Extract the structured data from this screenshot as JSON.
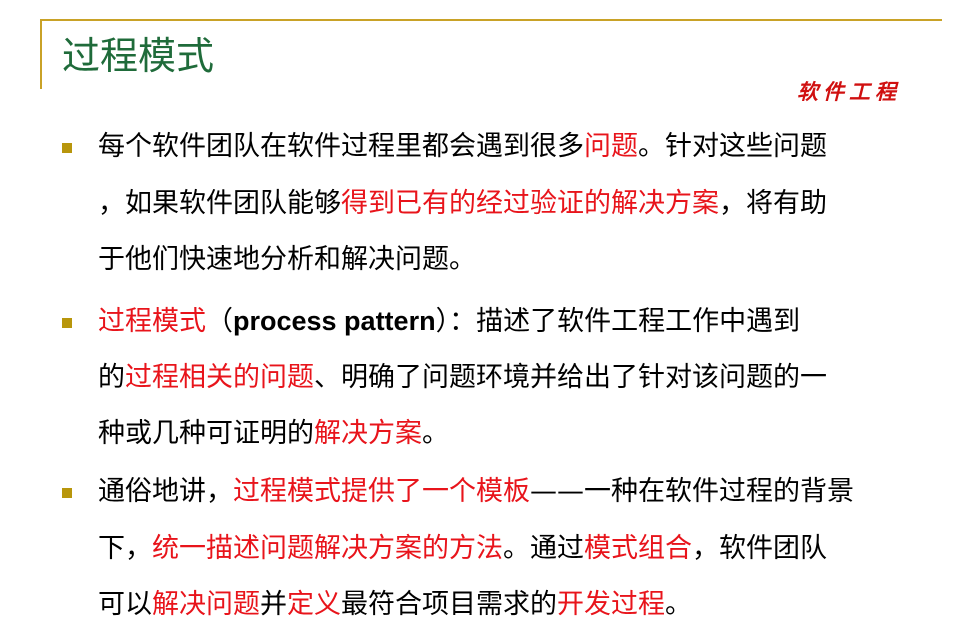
{
  "slide": {
    "title": "过程模式",
    "brand": "软件工程",
    "colors": {
      "title": "#1f6b3a",
      "accent_rule": "#c9a227",
      "bullet": "#b8960c",
      "highlight": "#e8141b",
      "text": "#000000"
    }
  },
  "p1": {
    "l1a": "每个软件团队在软件过程里都会遇到很多",
    "l1b": "问题",
    "l1c": "。针对这些问题",
    "l2a": "，如果软件团队能够",
    "l2b": "得到已有的经过验证的解决方案",
    "l2c": "，将有助",
    "l3a": "于他们快速地分析和解决问题。"
  },
  "p2": {
    "l1a": "过程模式",
    "l1b": "（",
    "l1c": "process pattern",
    "l1d": "）：描述了软件工程工作中遇到",
    "l2a": "的",
    "l2b": "过程相关的问题",
    "l2c": "、明确了问题环境并给出了针对该问题的一",
    "l3a": "种或几种可证明的",
    "l3b": "解决方案",
    "l3c": "。"
  },
  "p3": {
    "l1a": "通俗地讲，",
    "l1b": "过程模式提供了一个模板",
    "l1c": "——",
    "l1d": "一种在软件过程的背景",
    "l2a": "下，",
    "l2b": "统一描述问题解决方案的方法",
    "l2c": "。通过",
    "l2d": "模式组合",
    "l2e": "，软件团队",
    "l3a": "可以",
    "l3b": "解决问题",
    "l3c": "并",
    "l3d": "定义",
    "l3e": "最符合项目需求的",
    "l3f": "开发过程",
    "l3g": "。"
  }
}
